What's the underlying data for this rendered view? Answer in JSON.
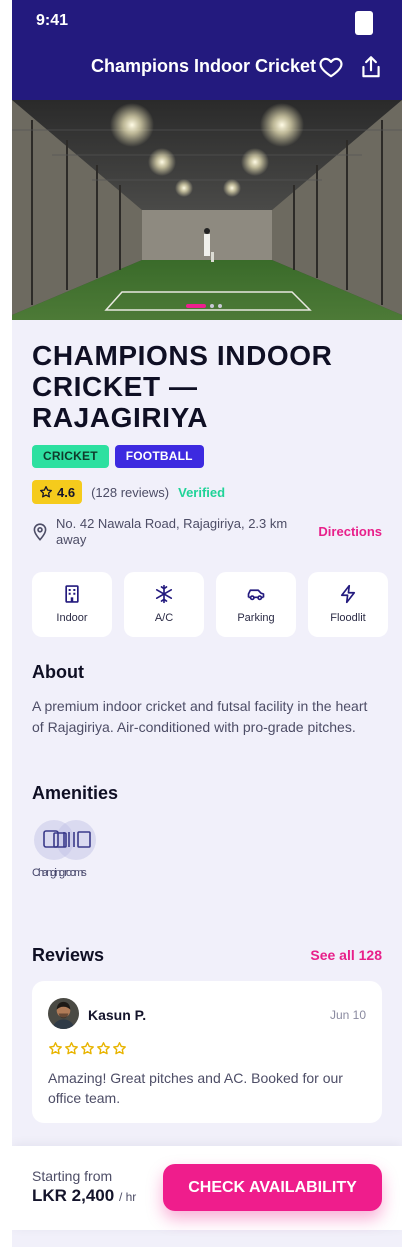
{
  "status_bar": {
    "time": "9:41"
  },
  "header": {
    "title": "Champions Indoor Cricket",
    "favorite_icon": "heart-icon",
    "share_icon": "share-icon"
  },
  "hero": {
    "slide_count": 3,
    "active_slide": 1
  },
  "venue": {
    "title": "CHAMPIONS INDOOR CRICKET — RAJAGIRIYA",
    "tags": [
      "CRICKET",
      "FOOTBALL"
    ],
    "rating": "4.6",
    "reviews_count": "(128 reviews)",
    "verified_label": "Verified",
    "address": "No. 42 Nawala Road, Rajagiriya, 2.3 km away",
    "directions_label": "Directions"
  },
  "features": [
    {
      "label": "Indoor",
      "icon": "building-icon"
    },
    {
      "label": "A/C",
      "icon": "snowflake-icon"
    },
    {
      "label": "Parking",
      "icon": "car-icon"
    },
    {
      "label": "Floodlit",
      "icon": "lightning-icon"
    }
  ],
  "about": {
    "heading": "About",
    "text": "A premium indoor cricket and futsal facility in the heart of Rajagiriya. Air-conditioned with pro-grade pitches."
  },
  "amenities": {
    "heading": "Amenities",
    "overlapped_label": "Changing rooms"
  },
  "reviews": {
    "heading": "Reviews",
    "see_all_label": "See all 128",
    "items": [
      {
        "name": "Kasun P.",
        "date": "Jun 10",
        "stars": 5,
        "text": "Amazing! Great pitches and AC. Booked for our office team."
      }
    ]
  },
  "booking": {
    "from_label": "Starting from",
    "price": "LKR 2,400",
    "unit": "/ hr",
    "cta_label": "CHECK AVAILABILITY"
  },
  "colors": {
    "header_bg": "#231a7e",
    "accent": "#ef1d8c",
    "verified": "#20d398",
    "rating": "#f5cb1c",
    "tag_green": "#2de0a0",
    "tag_purple": "#3d2ae0"
  }
}
